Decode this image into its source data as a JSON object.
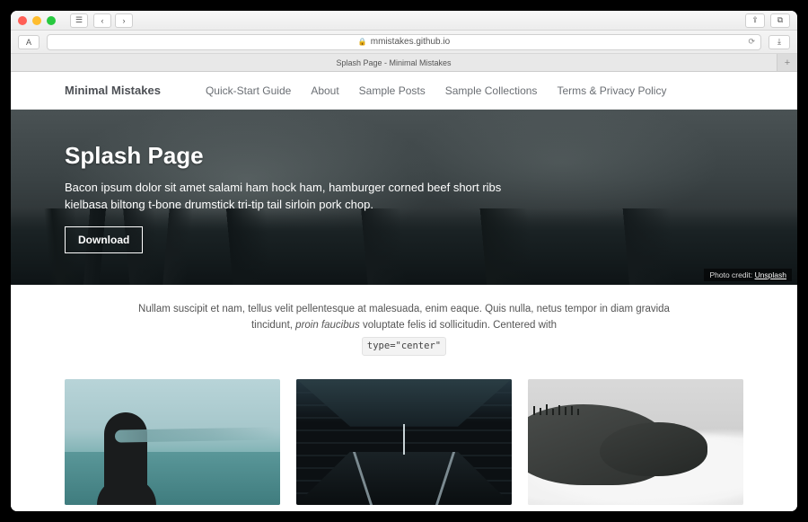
{
  "browser": {
    "url_host": "mmistakes.github.io",
    "tab_title": "Splash Page - Minimal Mistakes"
  },
  "nav": {
    "site_title": "Minimal Mistakes",
    "items": [
      {
        "label": "Quick-Start Guide"
      },
      {
        "label": "About"
      },
      {
        "label": "Sample Posts"
      },
      {
        "label": "Sample Collections"
      },
      {
        "label": "Terms & Privacy Policy"
      }
    ]
  },
  "hero": {
    "title": "Splash Page",
    "excerpt": "Bacon ipsum dolor sit amet salami ham hock ham, hamburger corned beef short ribs kielbasa biltong t-bone drumstick tri-tip tail sirloin pork chop.",
    "button_label": "Download",
    "credit_prefix": "Photo credit: ",
    "credit_link": "Unsplash"
  },
  "intro": {
    "text_a": "Nullam suscipit et nam, tellus velit pellentesque at malesuada, enim eaque. Quis nulla, netus tempor in diam gravida tincidunt, ",
    "text_em": "proin faucibus",
    "text_b": " voluptate felis id sollicitudin. Centered with",
    "code": "type=\"center\""
  }
}
